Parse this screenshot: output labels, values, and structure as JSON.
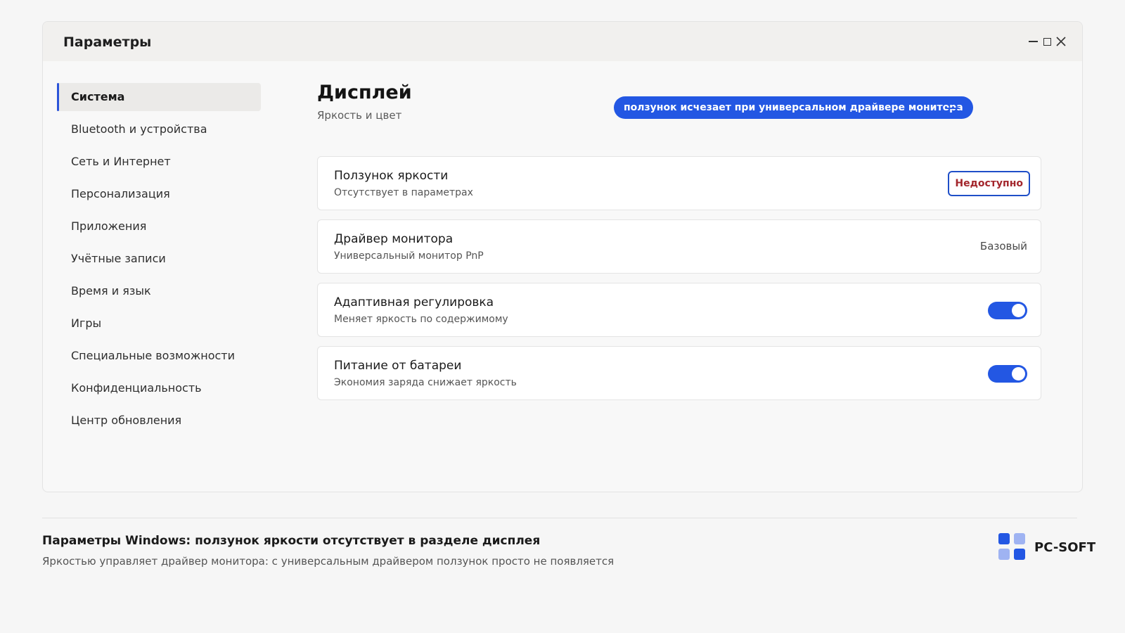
{
  "window": {
    "title": "Параметры"
  },
  "sidebar": {
    "items": [
      {
        "label": "Система",
        "active": true
      },
      {
        "label": "Bluetooth и устройства"
      },
      {
        "label": "Сеть и Интернет"
      },
      {
        "label": "Персонализация"
      },
      {
        "label": "Приложения"
      },
      {
        "label": "Учётные записи"
      },
      {
        "label": "Время и язык"
      },
      {
        "label": "Игры"
      },
      {
        "label": "Специальные возможности"
      },
      {
        "label": "Конфиденциальность"
      },
      {
        "label": "Центр обновления"
      }
    ]
  },
  "main": {
    "title": "Дисплей",
    "subtitle": "Яркость и цвет",
    "callout": "ползунок исчезает при универсальном драйвере монитора",
    "cards": [
      {
        "title": "Ползунок яркости",
        "description": "Отсутствует в параметрах",
        "status": "Недоступно"
      },
      {
        "title": "Драйвер монитора",
        "description": "Универсальный монитор PnP",
        "value": "Базовый"
      },
      {
        "title": "Адаптивная регулировка",
        "description": "Меняет яркость по содержимому",
        "toggle_on": true
      },
      {
        "title": "Питание от батареи",
        "description": "Экономия заряда снижает яркость",
        "toggle_on": true
      }
    ]
  },
  "footer": {
    "title": "Параметры Windows: ползунок яркости отсутствует в разделе дисплея",
    "subtitle": "Яркостью управляет драйвер монитора: с универсальным драйвером ползунок просто не появляется",
    "brand": "PC-SOFT"
  },
  "colors": {
    "accent": "#2357e3",
    "badge_text": "#a3262c",
    "brand_dark": "#2357e3",
    "brand_light": "#9fb3f2"
  }
}
